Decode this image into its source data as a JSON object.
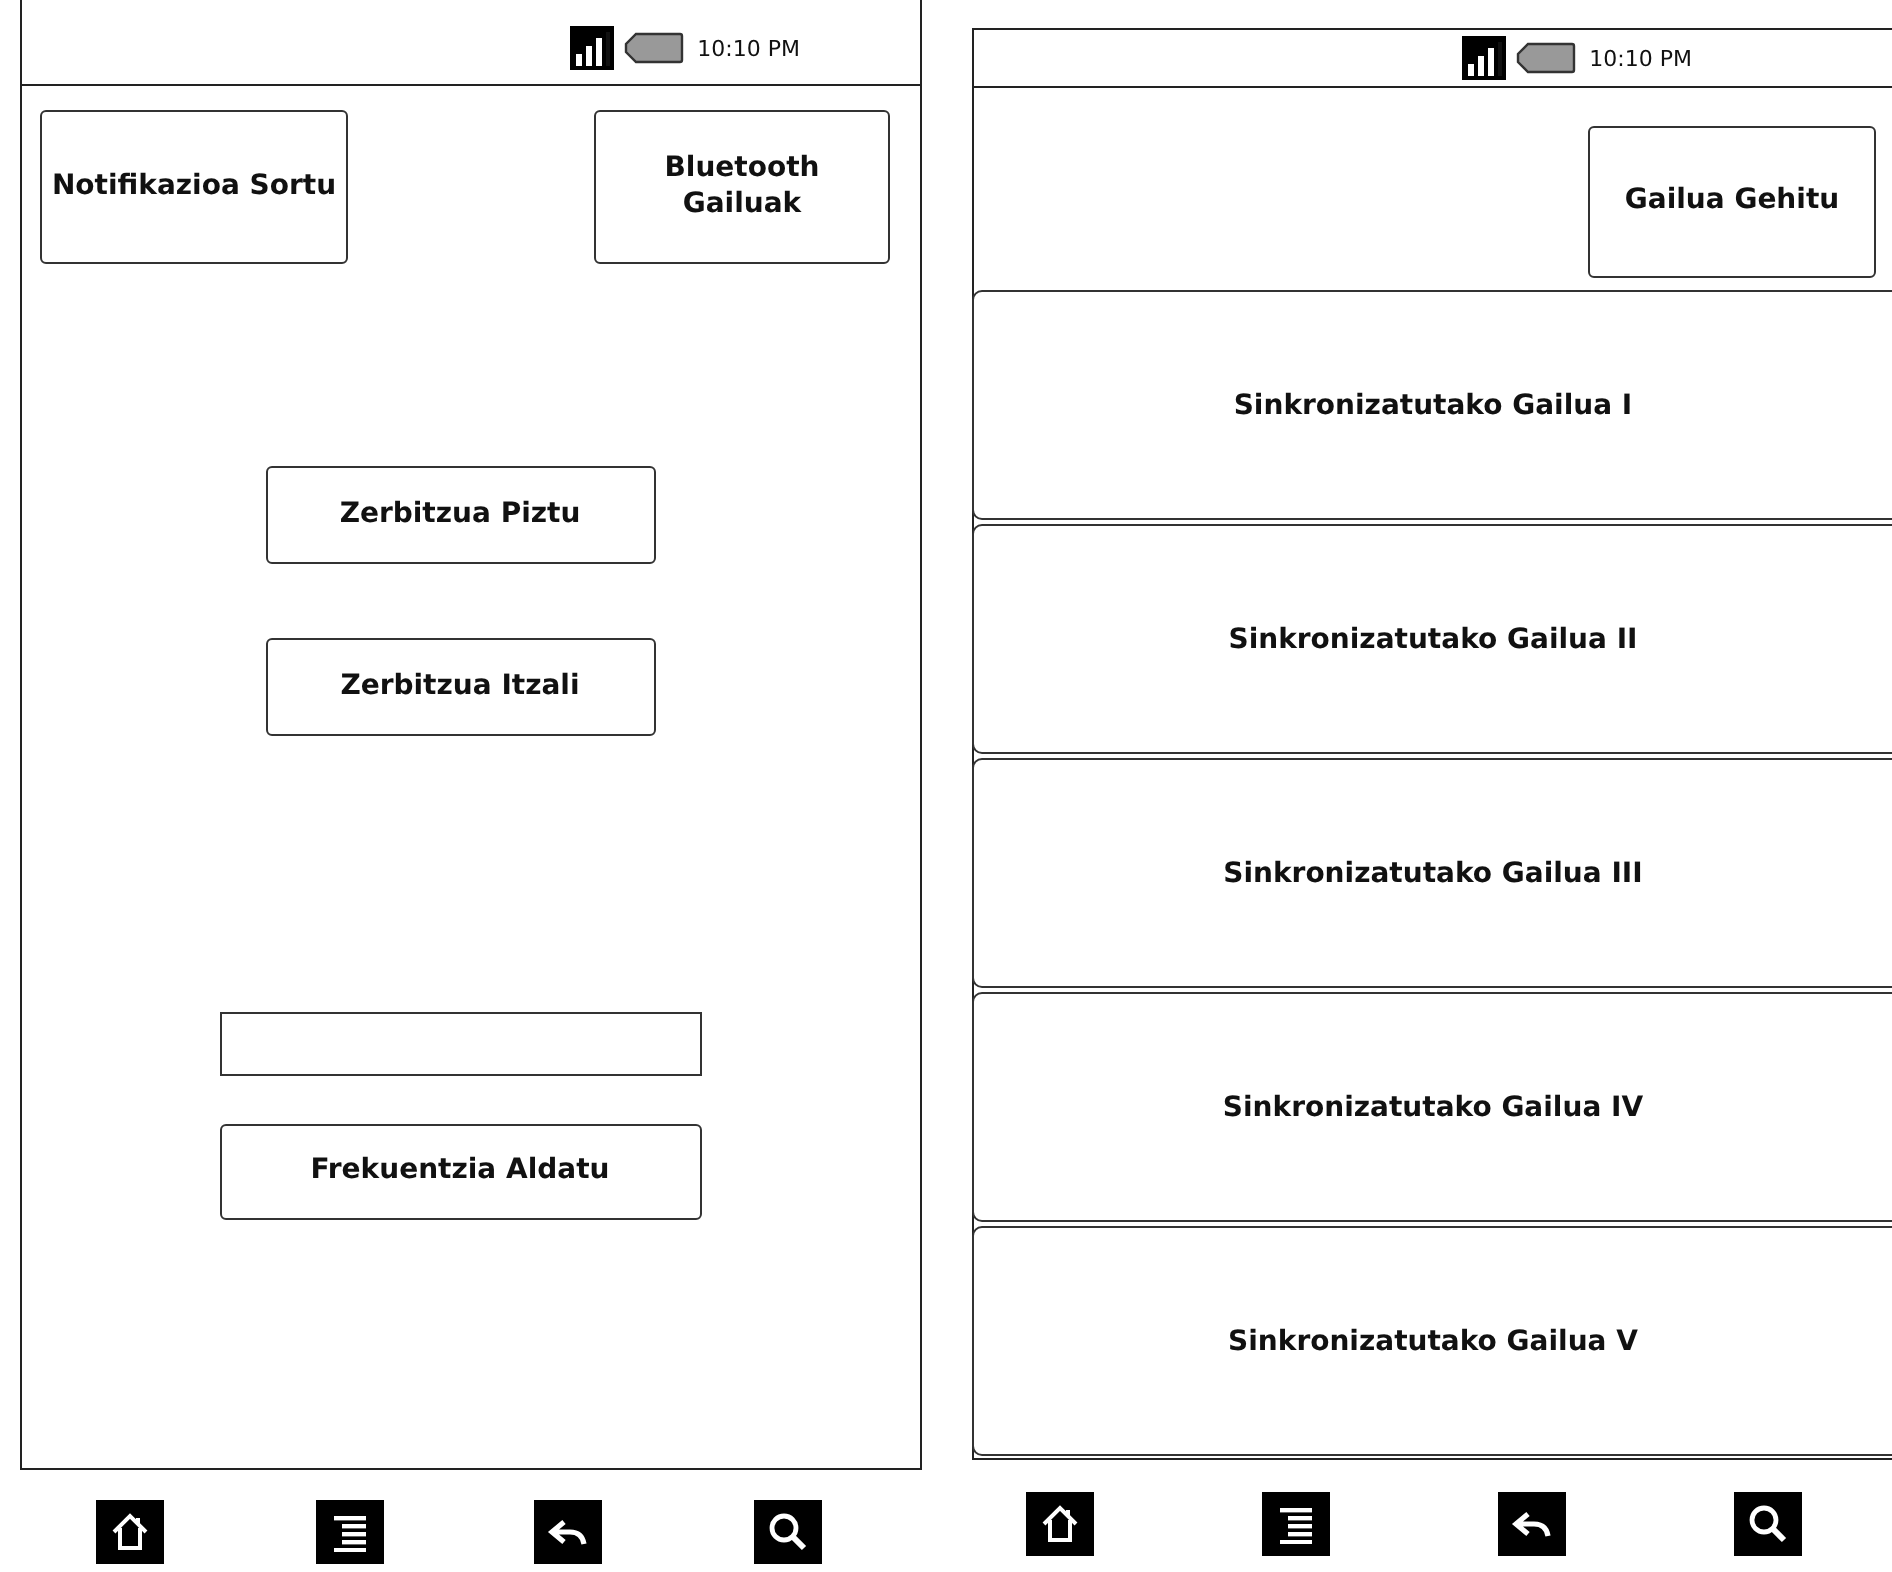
{
  "main_screen": {
    "status_bar": {
      "time": "10:10 PM"
    },
    "top_buttons": [
      "Notifikazioa Sortu",
      "Bluetooth Gailuak"
    ],
    "service_buttons": [
      "Zerbitzua Piztu",
      "Zerbitzua Itzali"
    ],
    "frequency_button": "Frekuentzia Aldatu"
  },
  "devices_screen": {
    "status_bar": {
      "time": "10:10 PM"
    },
    "add_button": "Gailua Gehitu",
    "devices": [
      "Sinkronizatutako Gailua I",
      "Sinkronizatutako Gailua II",
      "Sinkronizatutako Gailua III",
      "Sinkronizatutako Gailua IV",
      "Sinkronizatutako Gailua V"
    ]
  }
}
